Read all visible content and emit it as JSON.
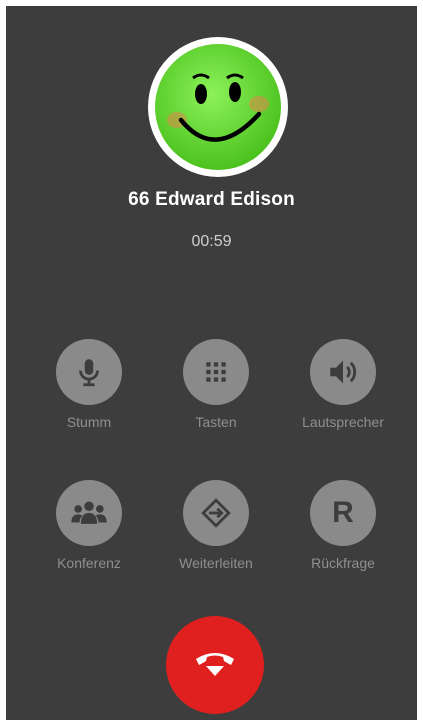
{
  "caller": {
    "name": "66 Edward Edison",
    "duration": "00:59",
    "avatar_icon": "smiley-face-icon"
  },
  "controls": {
    "mute": {
      "label": "Stumm",
      "icon": "microphone-icon"
    },
    "keypad": {
      "label": "Tasten",
      "icon": "dialpad-icon"
    },
    "speaker": {
      "label": "Lautsprecher",
      "icon": "speaker-icon"
    },
    "conference": {
      "label": "Konferenz",
      "icon": "group-icon"
    },
    "transfer": {
      "label": "Weiterleiten",
      "icon": "transfer-icon"
    },
    "consult": {
      "label": "Rückfrage",
      "icon": "r-letter-icon",
      "glyph": "R"
    }
  },
  "hangup": {
    "icon": "hang-up-icon"
  },
  "colors": {
    "background": "#3d3d3d",
    "button": "#8a8a8a",
    "label": "#8f8f8f",
    "hangup": "#e0201e",
    "avatar": "#6be031"
  }
}
